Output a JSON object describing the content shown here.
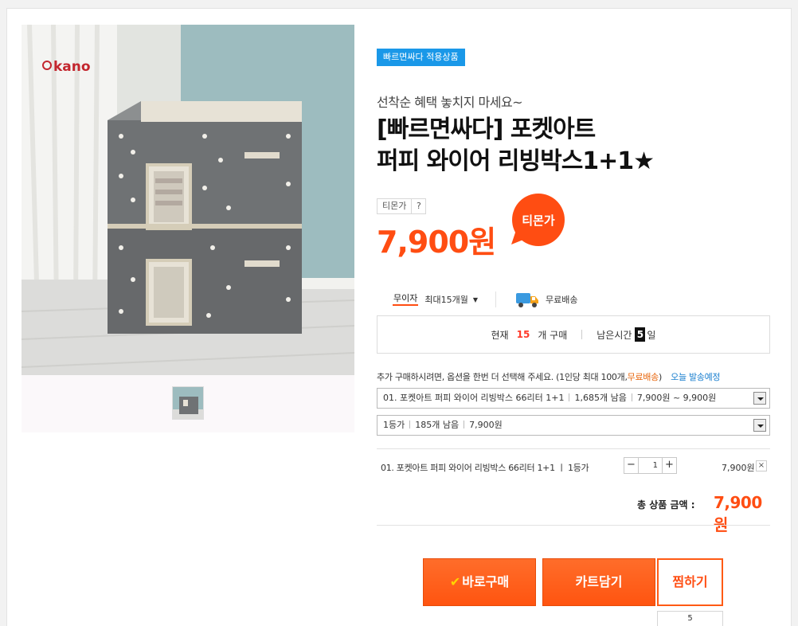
{
  "gallery": {
    "brand_logo": "kano",
    "thumbnails": [
      "thumbnail-1"
    ]
  },
  "product": {
    "badge": "빠르면싸다 적용상품",
    "subtitle": "선착순 혜택 놓치지 마세요~",
    "title_line1": "[빠르면싸다] 포켓아트",
    "title_line2": "퍼피 와이어 리빙박스1+1★",
    "price_label": "티몬가",
    "price_help": "?",
    "price": "7,900원",
    "bubble_text": "티몬가"
  },
  "benefits": {
    "interest_free_tag": "무이자",
    "installment_text": "최대15개월",
    "shipping_text": "무료배송"
  },
  "status": {
    "current_label": "현재",
    "current_count": "15",
    "current_suffix": "개 구매",
    "remaining_label": "남은시간",
    "remaining_days": "5",
    "remaining_suffix": "일"
  },
  "options": {
    "notice_text": "추가 구매하시려면, 옵션을 한번 더 선택해 주세요. (1인당 최대 100개,",
    "notice_free": "무료배송",
    "notice_close": ")",
    "notice_today": "오늘 발송예정",
    "select1": {
      "name": "01. 포켓아트 퍼피 와이어 리빙박스 66리터 1+1",
      "stock": "1,685개 남음",
      "price_range": "7,900원 ~ 9,900원"
    },
    "select2": {
      "grade": "1등가",
      "stock": "185개 남음",
      "price": "7,900원"
    }
  },
  "selected_item": {
    "name": "01. 포켓아트 퍼피 와이어 리빙박스 66리터 1+1 ㅣ 1등가",
    "minus": "−",
    "quantity": "1",
    "plus": "+",
    "price": "7,900원",
    "remove": "×"
  },
  "total": {
    "label": "총 상품 금액 :",
    "amount": "7,900원"
  },
  "actions": {
    "buy_check": "✔",
    "buy_now": "바로구매",
    "add_to_cart": "카트담기",
    "wishlist": "찜하기",
    "wishlist_count": "5"
  },
  "colors": {
    "accent": "#ff5a14",
    "badge": "#1a98e8",
    "price": "#ff4d12"
  }
}
